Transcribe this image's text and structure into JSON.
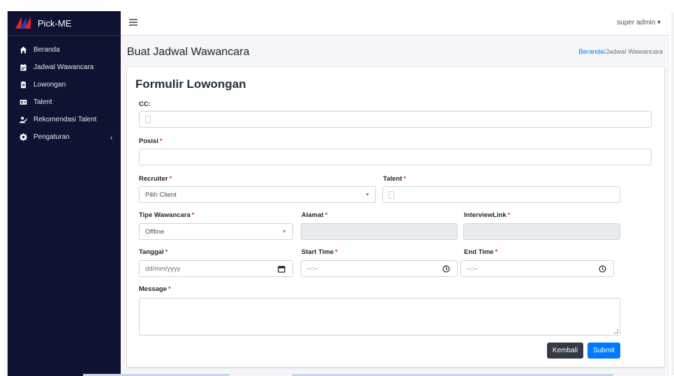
{
  "brand": {
    "name": "Pick-ME"
  },
  "sidebar": {
    "items": [
      {
        "label": "Beranda",
        "icon": "home-icon"
      },
      {
        "label": "Jadwal Wawancara",
        "icon": "calendar-icon"
      },
      {
        "label": "Lowongan",
        "icon": "clipboard-icon"
      },
      {
        "label": "Talent",
        "icon": "id-card-icon"
      },
      {
        "label": "Rekomendasi Talent",
        "icon": "user-check-icon"
      },
      {
        "label": "Pengaturan",
        "icon": "gear-icon",
        "chevron": "‹"
      }
    ]
  },
  "topbar": {
    "user": "super admin ▾"
  },
  "header": {
    "title": "Buat Jadwal Wawancara"
  },
  "breadcrumb": {
    "home": "Beranda",
    "separator": "/",
    "current": "Jadwal Wawancara"
  },
  "form": {
    "title": "Formulir Lowongan",
    "cc": {
      "label": "CC:"
    },
    "posisi": {
      "label": "Posisi",
      "req": "*"
    },
    "recruiter": {
      "label": "Recruiter",
      "req": "*",
      "value": "Pilih Client"
    },
    "talent": {
      "label": "Talent",
      "req": "*"
    },
    "tipe": {
      "label": "Tipe Wawancara",
      "req": "*",
      "value": "Offline"
    },
    "alamat": {
      "label": "Alamat",
      "req": "*"
    },
    "link": {
      "label": "InterviewLink",
      "req": "*"
    },
    "tanggal": {
      "label": "Tanggal",
      "req": "*",
      "placeholder": "dd/mm/yyyy"
    },
    "start": {
      "label": "Start Time",
      "req": "*",
      "placeholder": "--:--"
    },
    "end": {
      "label": "End Time",
      "req": "*",
      "placeholder": "--:--"
    },
    "message": {
      "label": "Message",
      "req": "*"
    },
    "buttons": {
      "back": "Kembali",
      "submit": "Submit"
    }
  },
  "colors": {
    "sidebar": "#0f1230",
    "primary": "#007bff",
    "dark": "#343a40",
    "required": "#dc3545"
  }
}
